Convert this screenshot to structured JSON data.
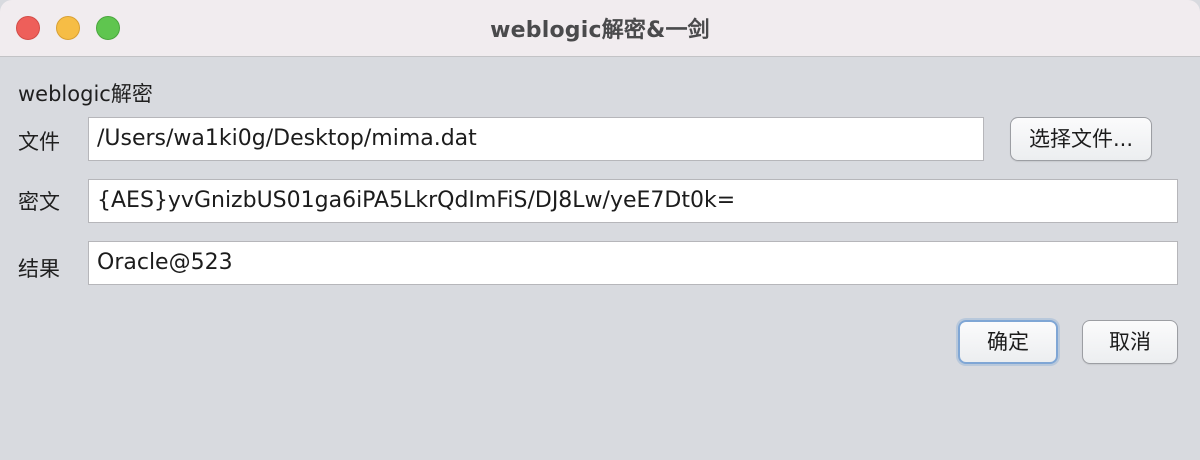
{
  "window": {
    "title": "weblogic解密&一剑"
  },
  "panel": {
    "heading": "weblogic解密"
  },
  "rows": {
    "file": {
      "label": "文件",
      "value": "/Users/wa1ki0g/Desktop/mima.dat"
    },
    "ciphertext": {
      "label": "密文",
      "value": "{AES}yvGnizbUS01ga6iPA5LkrQdImFiS/DJ8Lw/yeE7Dt0k="
    },
    "result": {
      "label": "结果",
      "value": "Oracle@523"
    }
  },
  "buttons": {
    "choose_file": "选择文件...",
    "ok": "确定",
    "cancel": "取消"
  },
  "colors": {
    "close": "#ee5f5a",
    "minimize": "#f6bd45",
    "maximize": "#5fc54f",
    "default_button_ring": "#7fa6d5"
  }
}
